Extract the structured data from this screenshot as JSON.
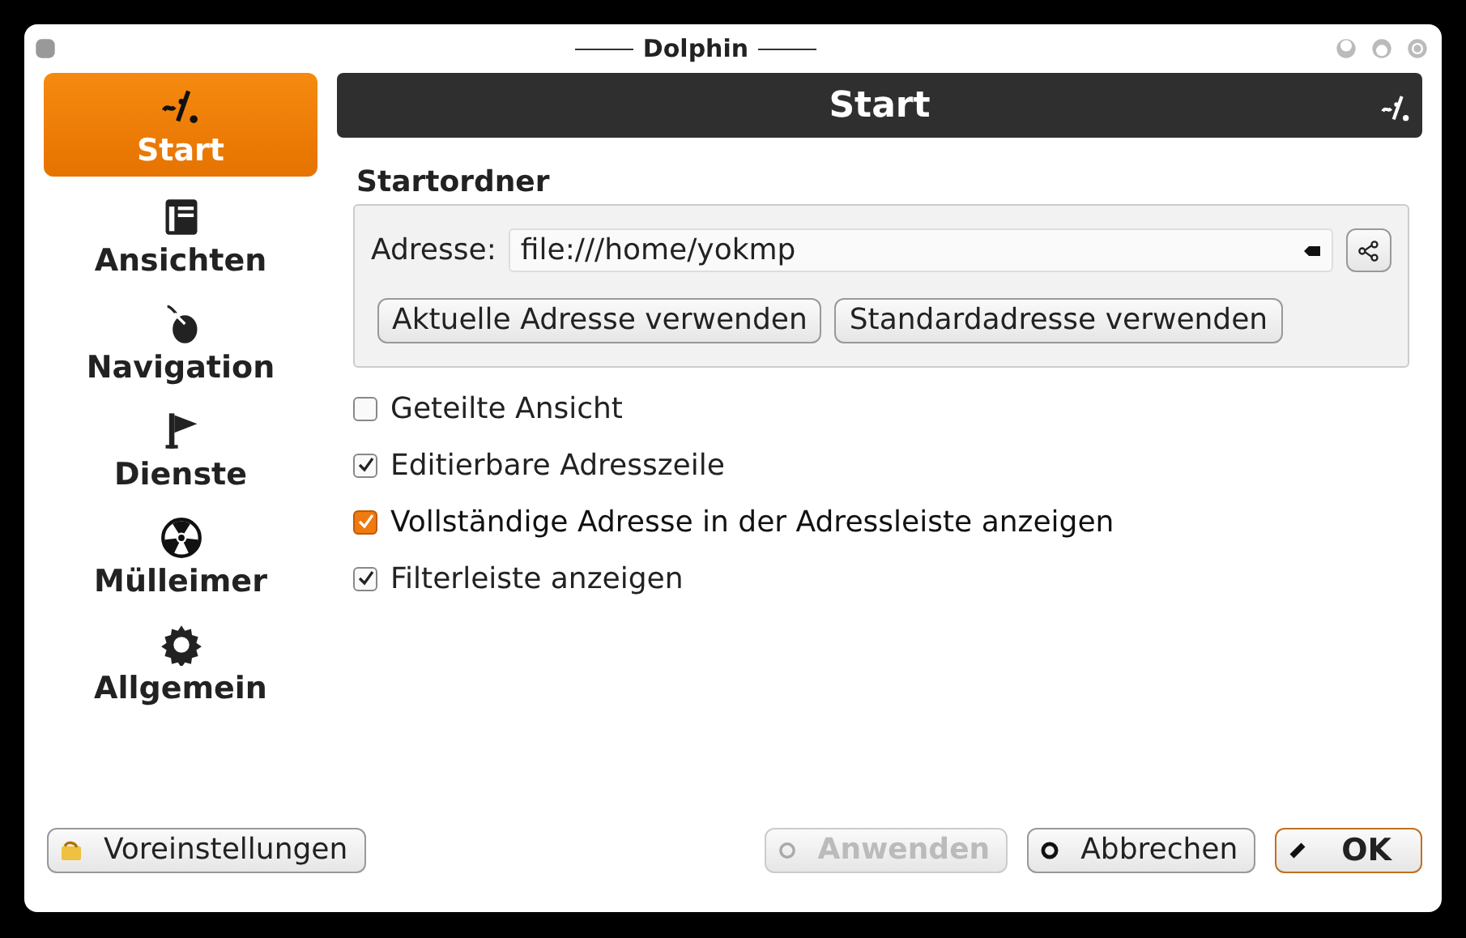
{
  "window": {
    "title": "Dolphin"
  },
  "sidebar": {
    "items": [
      {
        "label": "Start",
        "selected": true
      },
      {
        "label": "Ansichten",
        "selected": false
      },
      {
        "label": "Navigation",
        "selected": false
      },
      {
        "label": "Dienste",
        "selected": false
      },
      {
        "label": "Mülleimer",
        "selected": false
      },
      {
        "label": "Allgemein",
        "selected": false
      }
    ]
  },
  "header": {
    "title": "Start"
  },
  "group": {
    "title": "Startordner",
    "address_label": "Adresse:",
    "address_value": "file:///home/yokmp",
    "buttons": [
      "Aktuelle Adresse verwenden",
      "Standardadresse verwenden"
    ]
  },
  "options": [
    {
      "label": "Geteilte Ansicht",
      "checked": false,
      "hovered": false
    },
    {
      "label": "Editierbare Adresszeile",
      "checked": true,
      "hovered": false
    },
    {
      "label": "Vollständige Adresse in der Adressleiste anzeigen",
      "checked": true,
      "hovered": true
    },
    {
      "label": "Filterleiste anzeigen",
      "checked": true,
      "hovered": false
    }
  ],
  "footer": {
    "defaults_button": "Voreinstellungen",
    "buttons": [
      {
        "label": "Anwenden",
        "disabled": true,
        "default": false
      },
      {
        "label": "Abbrechen",
        "disabled": false,
        "default": false
      },
      {
        "label": "OK",
        "disabled": false,
        "default": true
      }
    ]
  }
}
